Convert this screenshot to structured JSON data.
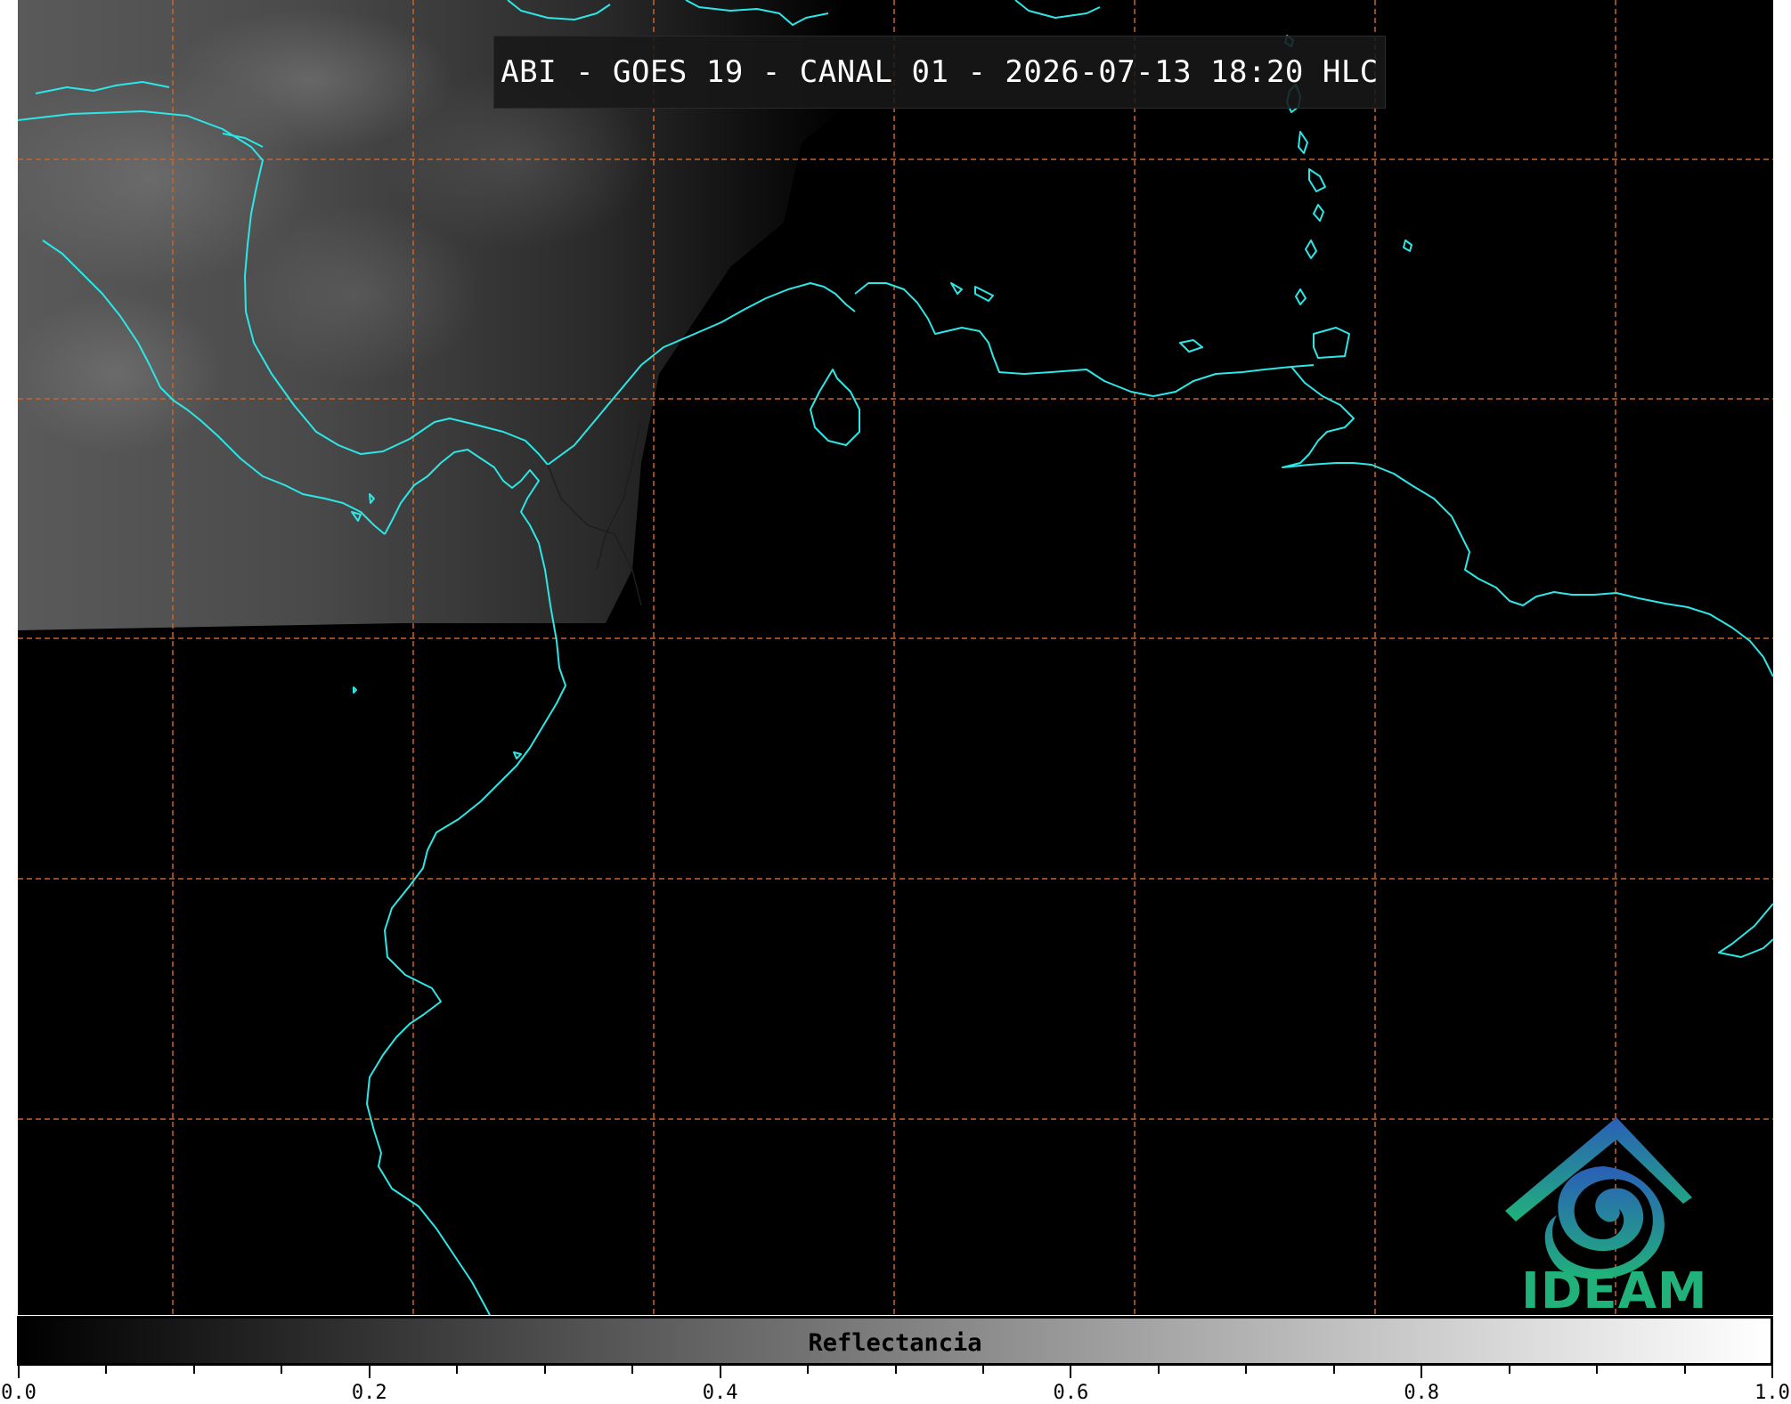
{
  "title": "ABI - GOES 19 - CANAL 01 - 2026-07-13 18:20 HLC",
  "colorbar": {
    "label": "Reflectancia",
    "ticks": [
      "0.0",
      "0.2",
      "0.4",
      "0.6",
      "0.8",
      "1.0"
    ],
    "range": [
      0.0,
      1.0
    ],
    "colormap": [
      "#000000",
      "#ffffff"
    ]
  },
  "logo": {
    "text": "IDEAM",
    "color_top": "#2a7fb8",
    "color_bottom": "#20b27a"
  },
  "colors": {
    "coastline": "#2de6e6",
    "gridline": "#c8642a",
    "background": "#000000"
  }
}
